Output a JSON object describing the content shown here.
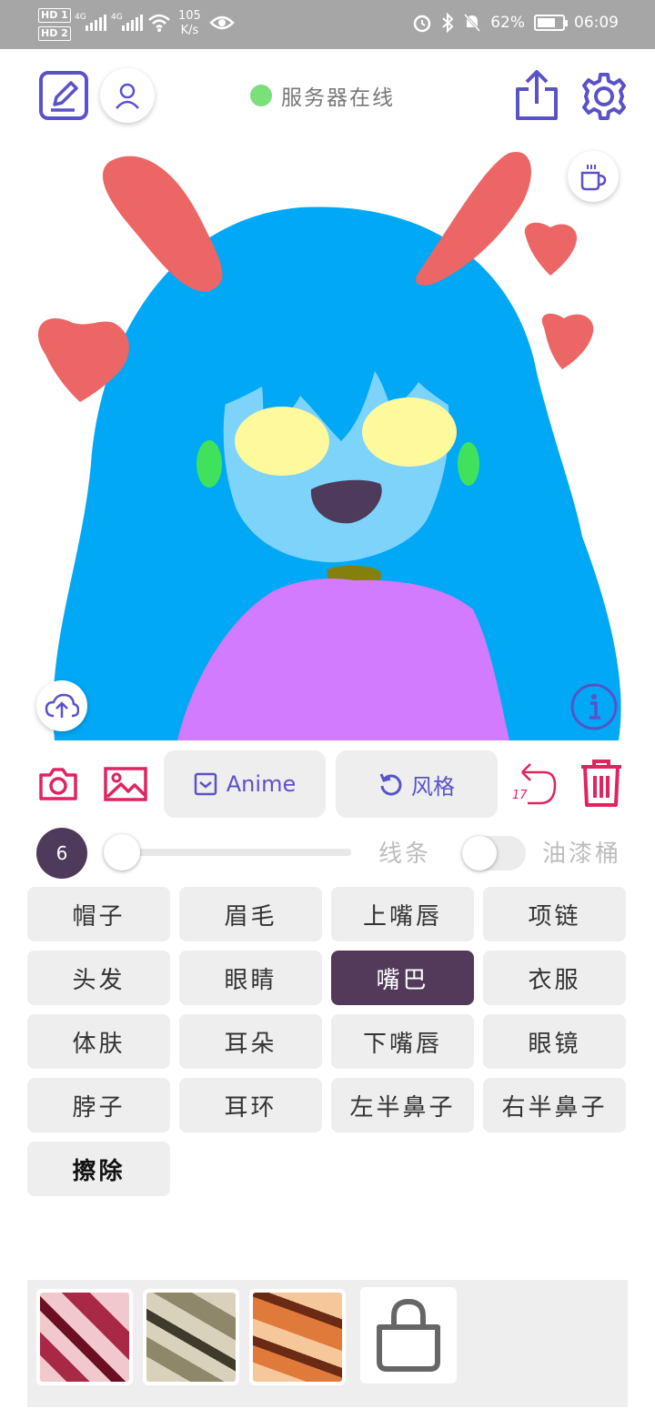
{
  "status_bar": {
    "hd1": "HD 1",
    "hd2": "HD 2",
    "sig1": "4G",
    "sig2": "4G",
    "speed_value": "105",
    "speed_unit": "K/s",
    "battery": "62%",
    "time": "06:09"
  },
  "header": {
    "server_status": "服务器在线",
    "server_status_color": "#7be07a",
    "accent": "#5a52c8"
  },
  "toolbar": {
    "anime_label": "Anime",
    "style_label": "风格",
    "undo_count": "17",
    "danger_color": "#e0245e"
  },
  "brush": {
    "size": "6",
    "size_slider_fraction": 0.0,
    "line_label": "线条",
    "bucket_label": "油漆桶",
    "bucket_enabled": false
  },
  "parts": [
    {
      "label": "帽子",
      "selected": false
    },
    {
      "label": "眉毛",
      "selected": false
    },
    {
      "label": "上嘴唇",
      "selected": false
    },
    {
      "label": "项链",
      "selected": false
    },
    {
      "label": "头发",
      "selected": false
    },
    {
      "label": "眼睛",
      "selected": false
    },
    {
      "label": "嘴巴",
      "selected": true
    },
    {
      "label": "衣服",
      "selected": false
    },
    {
      "label": "体肤",
      "selected": false
    },
    {
      "label": "耳朵",
      "selected": false
    },
    {
      "label": "下嘴唇",
      "selected": false
    },
    {
      "label": "眼镜",
      "selected": false
    },
    {
      "label": "脖子",
      "selected": false
    },
    {
      "label": "耳环",
      "selected": false
    },
    {
      "label": "左半鼻子",
      "selected": false
    },
    {
      "label": "右半鼻子",
      "selected": false
    },
    {
      "label": "擦除",
      "selected": false
    }
  ],
  "selected_color": "#533a5a",
  "style_thumbs": [
    {
      "name": "style-1",
      "colors": [
        "#a82846",
        "#f1c9cc",
        "#6b0f22"
      ]
    },
    {
      "name": "style-2",
      "colors": [
        "#8f876a",
        "#d8d2bd",
        "#3e3a2c"
      ]
    },
    {
      "name": "style-3",
      "colors": [
        "#e07a3a",
        "#f6c79b",
        "#6a2a14"
      ]
    }
  ]
}
